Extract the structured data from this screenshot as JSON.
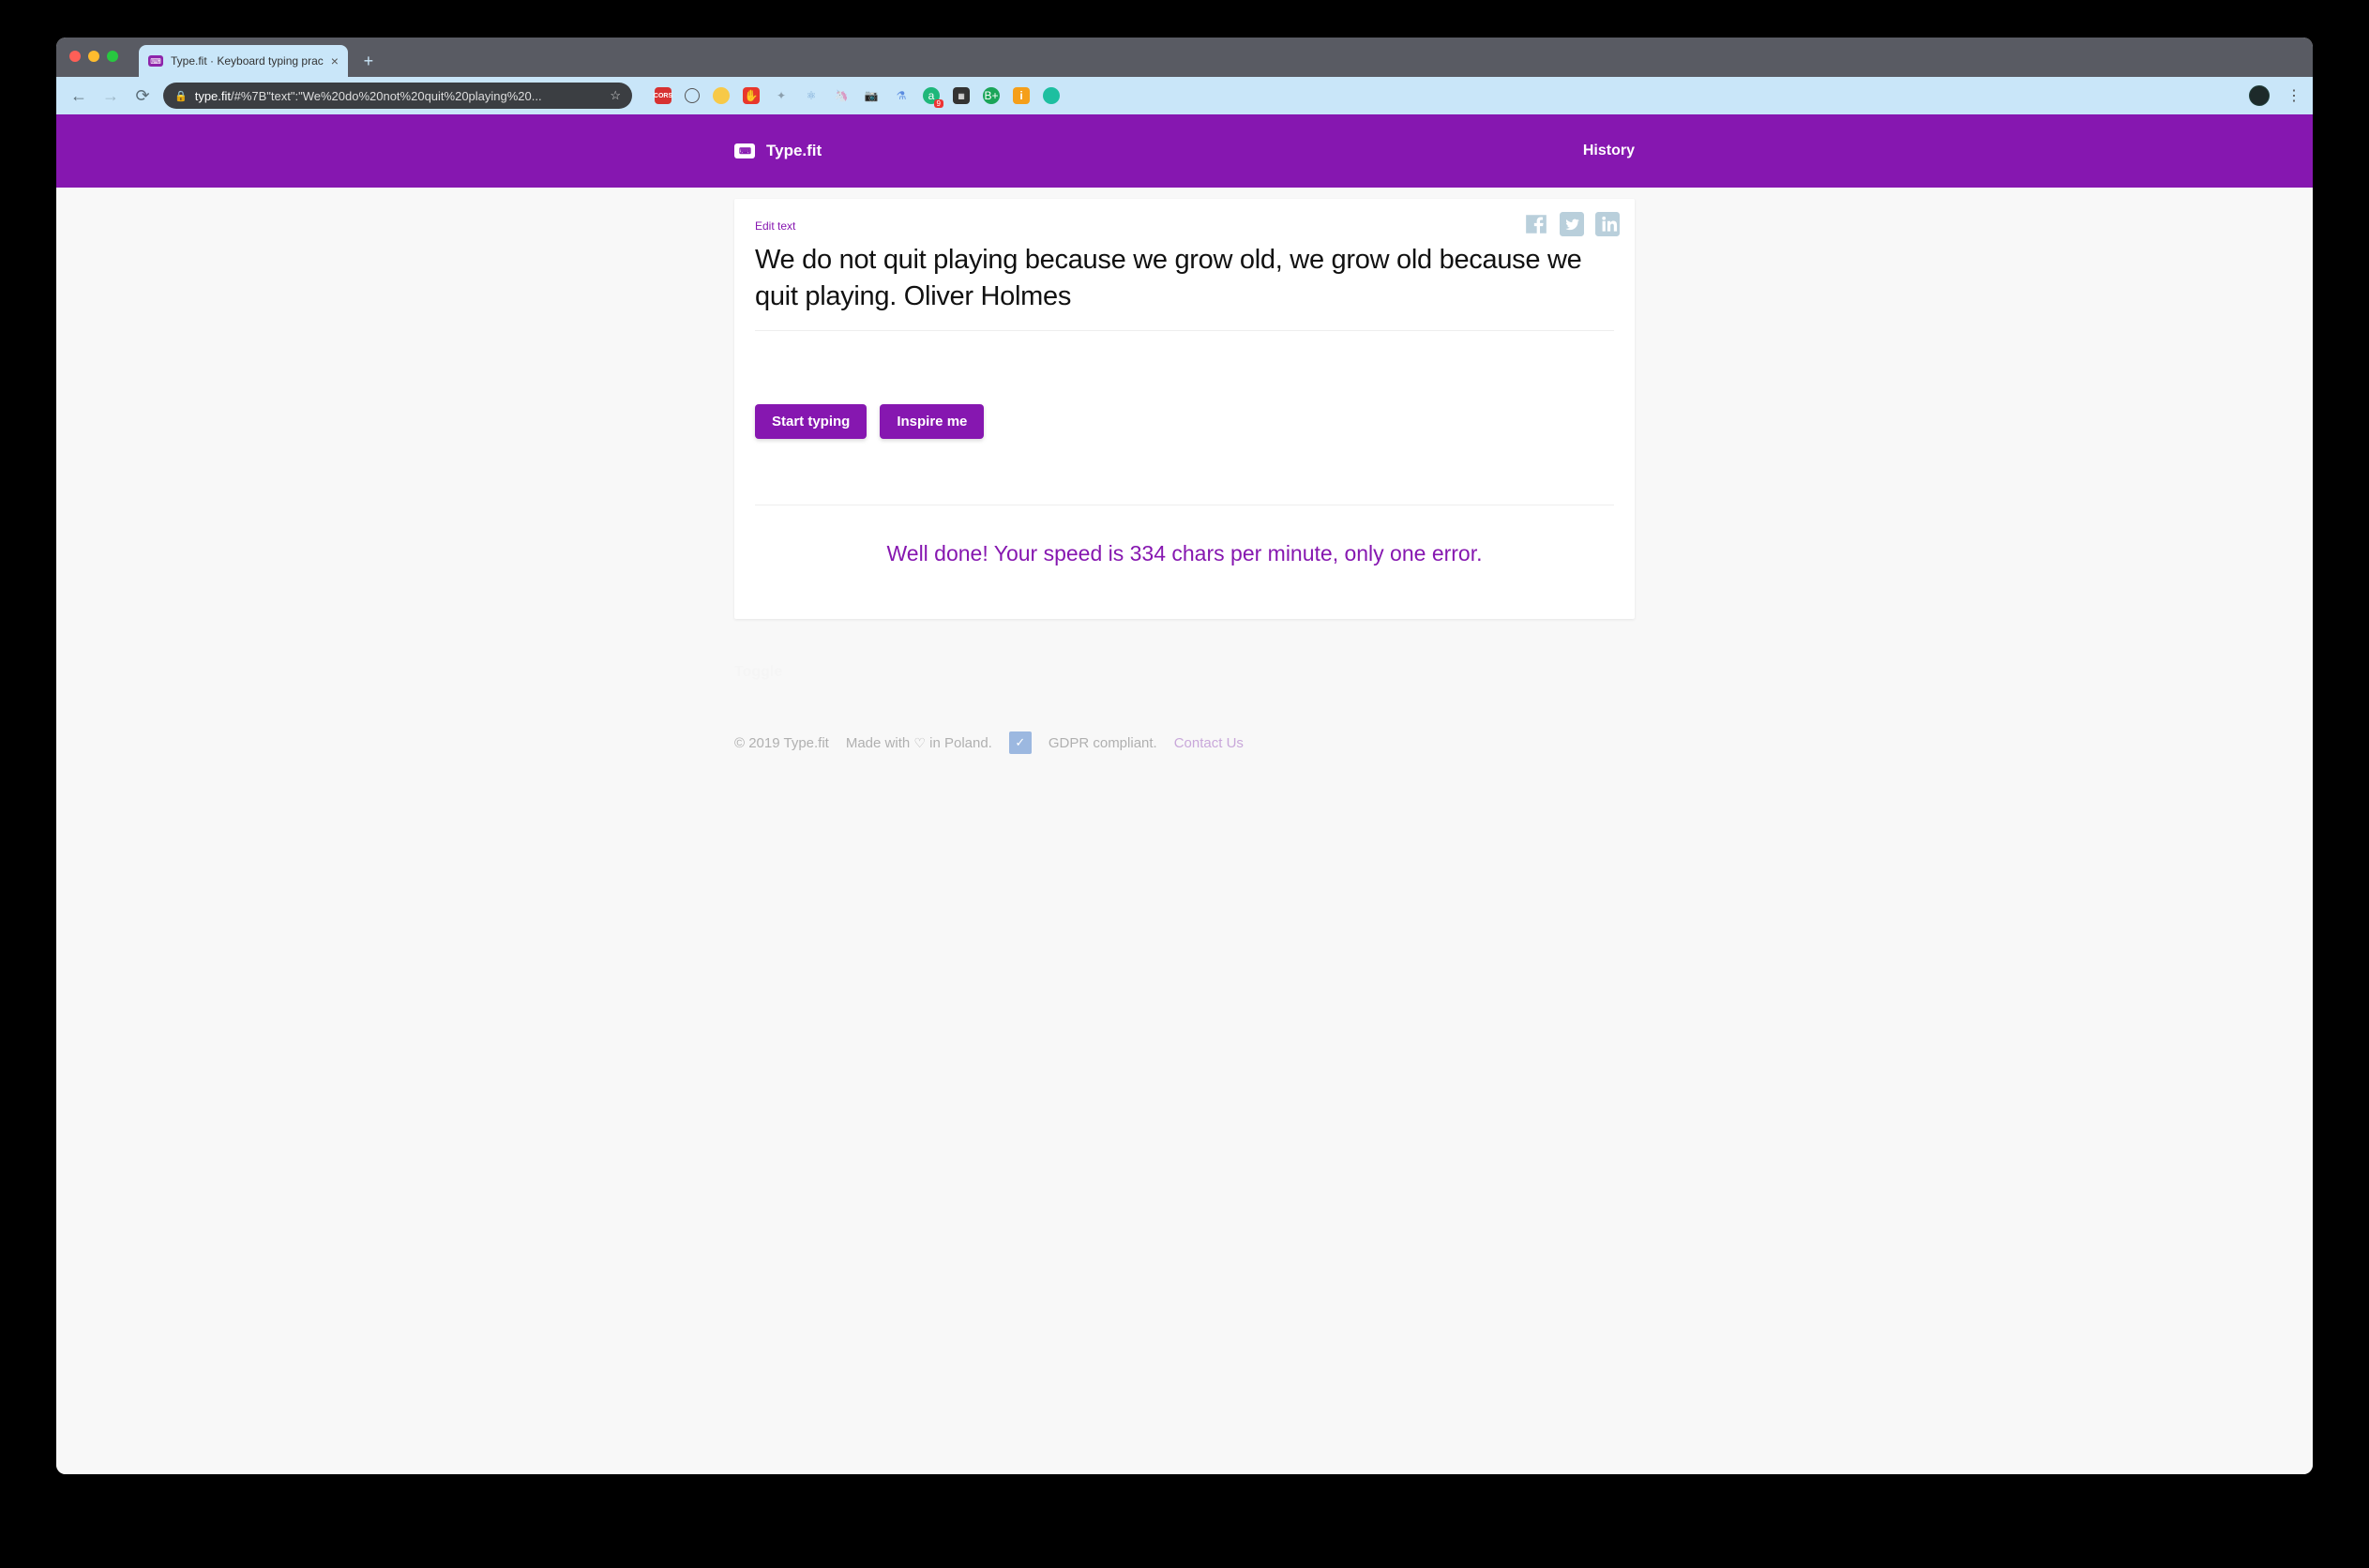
{
  "browser": {
    "tab_title": "Type.fit · Keyboard typing prac",
    "url_host": "type.fit",
    "url_path": "/#%7B\"text\":\"We%20do%20not%20quit%20playing%20...",
    "extensions": {
      "cors": "CORS",
      "badge_9": "9"
    }
  },
  "header": {
    "brand": "Type.fit",
    "history": "History"
  },
  "card": {
    "edit": "Edit text",
    "quote": "We do not quit playing because we grow old, we grow old because we quit playing. Oliver Holmes",
    "start": "Start typing",
    "inspire": "Inspire me",
    "result": "Well done! Your speed is 334 chars per minute, only one error."
  },
  "toggle": "Toggle",
  "footer": {
    "copyright": "© 2019 Type.fit",
    "made_pre": "Made with",
    "made_post": "in Poland.",
    "gdpr": "GDPR compliant.",
    "contact": "Contact Us"
  }
}
